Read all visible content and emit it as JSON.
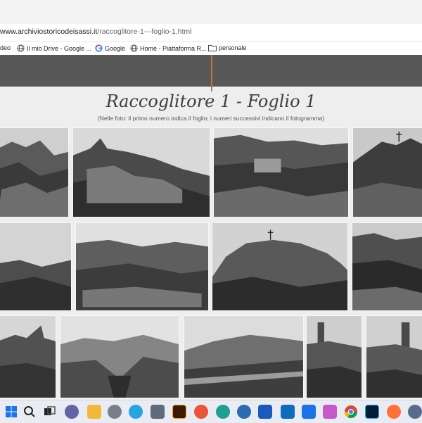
{
  "browser": {
    "url_host": "www.archiviostoricodeisassi.it",
    "url_path": "/raccoglitore-1---foglio-1.html",
    "bookmarks": [
      {
        "icon": "video-icon",
        "label": "ideo"
      },
      {
        "icon": "globe-icon",
        "label": "Il mio Drive - Google ..."
      },
      {
        "icon": "google-icon",
        "label": "Google"
      },
      {
        "icon": "globe-icon",
        "label": "Home - Piattaforma R..."
      },
      {
        "icon": "folder-icon",
        "label": "personale"
      }
    ]
  },
  "page": {
    "title": "Raccoglitore 1 - Foglio 1",
    "subtitle": "(Nelle foto: il primo numero indica il foglio; i numeri successivi indicano il fotogramma)"
  },
  "taskbar": {
    "icons": [
      "windows-start-icon",
      "search-icon",
      "task-view-icon",
      "teams-icon",
      "file-explorer-icon",
      "settings-icon",
      "telegram-icon",
      "calculator-icon",
      "illustrator-icon",
      "app-icon",
      "edge-icon",
      "app-icon",
      "word-icon",
      "outlook-icon",
      "app-icon",
      "chrome-icon",
      "photoshop-icon",
      "firefox-icon",
      "app-icon"
    ]
  },
  "colors": {
    "header_band": "#585858",
    "accent_line": "#b4764a",
    "page_bg": "#eeeeee"
  }
}
